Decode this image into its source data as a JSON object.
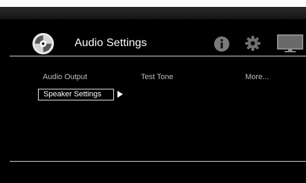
{
  "header": {
    "title": "Audio Settings",
    "icons": [
      "disc-icon",
      "info-icon",
      "gear-icon",
      "tv-icon"
    ]
  },
  "menu": {
    "items": [
      {
        "label": "Audio Output"
      },
      {
        "label": "Test Tone"
      },
      {
        "label": "More..."
      }
    ],
    "selected": {
      "label": "Speaker Settings"
    }
  },
  "colors": {
    "background": "#000000",
    "text_active": "#ffffff",
    "text_inactive": "#bdbdbd",
    "divider": "#d8d8d8"
  }
}
